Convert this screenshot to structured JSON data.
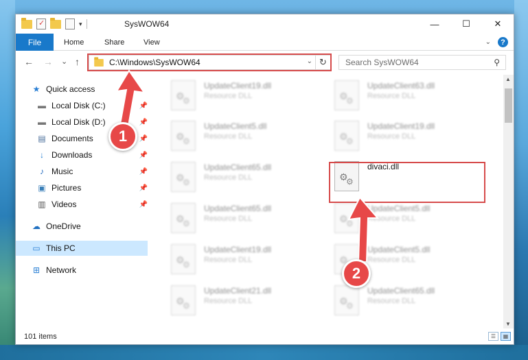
{
  "window": {
    "title": "SysWOW64",
    "controls": {
      "minimize": "—",
      "maximize": "☐",
      "close": "✕"
    }
  },
  "ribbon": {
    "tabs": [
      "File",
      "Home",
      "Share",
      "View"
    ],
    "expand_icon": "chevron-down-icon",
    "help_label": "?"
  },
  "nav": {
    "back": "←",
    "forward": "→",
    "recent": "⌄",
    "up": "↑",
    "address": "C:\\Windows\\SysWOW64",
    "refresh": "↻",
    "search_placeholder": "Search SysWOW64",
    "search_icon": "⚲"
  },
  "sidebar": {
    "items": [
      {
        "label": "Quick access",
        "icon": "star-icon",
        "glyph": "★",
        "pinned": false
      },
      {
        "label": "Local Disk (C:)",
        "icon": "drive-icon",
        "glyph": "▬",
        "pinned": true
      },
      {
        "label": "Local Disk (D:)",
        "icon": "drive-icon",
        "glyph": "▬",
        "pinned": true
      },
      {
        "label": "Documents",
        "icon": "documents-icon",
        "glyph": "▤",
        "pinned": true
      },
      {
        "label": "Downloads",
        "icon": "download-icon",
        "glyph": "↓",
        "pinned": true
      },
      {
        "label": "Music",
        "icon": "music-icon",
        "glyph": "♪",
        "pinned": true
      },
      {
        "label": "Pictures",
        "icon": "pictures-icon",
        "glyph": "▣",
        "pinned": true
      },
      {
        "label": "Videos",
        "icon": "videos-icon",
        "glyph": "▥",
        "pinned": true
      },
      {
        "label": "OneDrive",
        "icon": "cloud-icon",
        "glyph": "☁",
        "pinned": false
      },
      {
        "label": "This PC",
        "icon": "computer-icon",
        "glyph": "▭",
        "pinned": false,
        "selected": true
      },
      {
        "label": "Network",
        "icon": "network-icon",
        "glyph": "⊞",
        "pinned": false
      }
    ]
  },
  "files": {
    "left_column": [
      {
        "name": "UpdateClient19.dll",
        "type": "Resource DLL"
      },
      {
        "name": "UpdateClient5.dll",
        "type": "Resource DLL"
      },
      {
        "name": "UpdateClient65.dll",
        "type": "Resource DLL"
      },
      {
        "name": "UpdateClient65.dll",
        "type": "Resource DLL"
      },
      {
        "name": "UpdateClient19.dll",
        "type": "Resource DLL"
      },
      {
        "name": "UpdateClient21.dll",
        "type": "Resource DLL"
      }
    ],
    "right_column": [
      {
        "name": "UpdateClient63.dll",
        "type": "Resource DLL"
      },
      {
        "name": "UpdateClient19.dll",
        "type": "Resource DLL"
      },
      {
        "name": "divaci.dll",
        "type": "",
        "highlight": true
      },
      {
        "name": "UpdateClient5.dll",
        "type": "Resource DLL"
      },
      {
        "name": "UpdateClient5.dll",
        "type": "Resource DLL"
      },
      {
        "name": "UpdateClient65.dll",
        "type": "Resource DLL"
      }
    ]
  },
  "status": {
    "item_count": "101 items"
  },
  "callouts": [
    {
      "number": "1"
    },
    {
      "number": "2"
    }
  ],
  "colors": {
    "accent": "#1979ca",
    "callout": "#e74848",
    "highlight_box": "#d64a4a",
    "selection": "#cce8ff"
  }
}
